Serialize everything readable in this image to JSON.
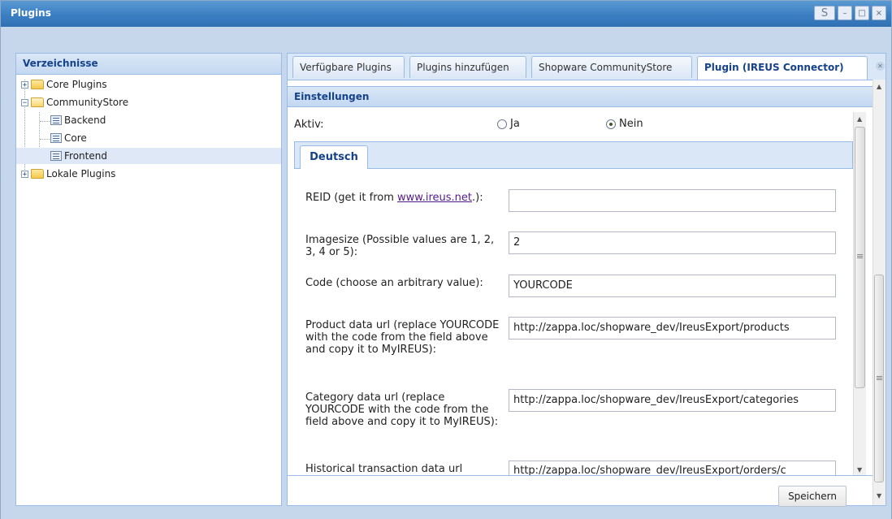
{
  "window": {
    "title": "Plugins",
    "refresh_glyph": "S",
    "minimize_glyph": "–",
    "maximize_glyph": "□",
    "close_glyph": "×"
  },
  "left_panel": {
    "title": "Verzeichnisse",
    "tree": [
      {
        "label": "Core Plugins",
        "type": "folder",
        "expanded": false,
        "icon": "folder-icon"
      },
      {
        "label": "CommunityStore",
        "type": "folder",
        "expanded": true,
        "icon": "folder-open-icon"
      },
      {
        "label": "Backend",
        "type": "leaf",
        "icon": "list-icon"
      },
      {
        "label": "Core",
        "type": "leaf",
        "icon": "list-icon"
      },
      {
        "label": "Frontend",
        "type": "leaf",
        "icon": "list-icon",
        "selected": true
      },
      {
        "label": "Lokale Plugins",
        "type": "folder",
        "expanded": false,
        "icon": "folder-icon"
      }
    ]
  },
  "tabs": [
    {
      "label": "Verfügbare Plugins"
    },
    {
      "label": "Plugins hinzufügen"
    },
    {
      "label": "Shopware CommunityStore"
    },
    {
      "label": "Plugin (IREUS Connector)",
      "active": true,
      "closable": true
    }
  ],
  "settings": {
    "header": "Einstellungen",
    "aktiv_label": "Aktiv:",
    "radio_ja": "Ja",
    "radio_nein": "Nein",
    "selected": "Nein",
    "language_tab": "Deutsch",
    "fields": [
      {
        "label_pre": "REID (get it from ",
        "link": "www.ireus.net",
        "label_post": ".):",
        "value": ""
      },
      {
        "label": "Imagesize (Possible values are 1, 2, 3, 4 or 5):",
        "value": "2"
      },
      {
        "label": "Code (choose an arbitrary value):",
        "value": "YOURCODE"
      },
      {
        "label": "Product data url (replace YOURCODE with the code from the field above and copy it to MyIREUS):",
        "value": "http://zappa.loc/shopware_dev/IreusExport/products"
      },
      {
        "label": "Category data url (replace YOURCODE with the code from the field above and copy it to MyIREUS):",
        "value": "http://zappa.loc/shopware_dev/IreusExport/categories"
      },
      {
        "label": "Historical transaction data url",
        "value": "http://zappa.loc/shopware_dev/IreusExport/orders/c"
      }
    ],
    "save_label": "Speichern"
  },
  "colors": {
    "title_bar": "#3b7fc2",
    "header_text": "#15428b",
    "panel_border": "#99bbe8",
    "selection": "#dfe8f6"
  }
}
